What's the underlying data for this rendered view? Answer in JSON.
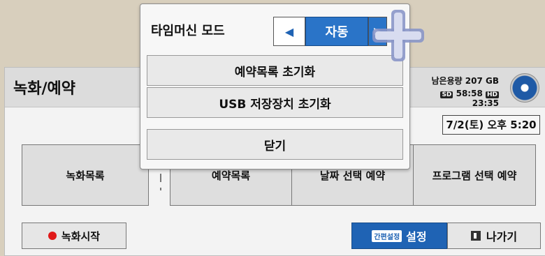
{
  "panel": {
    "title": "녹화/예약",
    "storage_remaining": "남은용량 207 GB",
    "sd_tag": "SD",
    "sd_time": "58:58",
    "hd_tag": "HD",
    "hd_time": "23:35",
    "datetime": "7/2(토) 오후 5:20"
  },
  "tabs": [
    {
      "label": "녹화목록"
    },
    {
      "label": "예약목록"
    },
    {
      "label": "날짜 선택 예약"
    },
    {
      "label": "프로그램 선택 예약"
    }
  ],
  "bottom": {
    "record_label": "녹화시작",
    "quick_tag": "간편설정",
    "settings_label": "설정",
    "exit_label": "나가기"
  },
  "popup": {
    "timemachine_label": "타임머신 모드",
    "mode_value": "자동",
    "left_arrow": "◀",
    "right_arrow": "▶",
    "items": [
      {
        "label": "예약목록 초기화"
      },
      {
        "label": "USB 저장장치 초기화"
      },
      {
        "label": "닫기"
      }
    ]
  },
  "colors": {
    "accent": "#2a74c8",
    "record_dot": "#e01919",
    "background": "#d8cfbd"
  },
  "icons": {
    "cursor": "plus-pointer-icon",
    "disc": "disc-icon",
    "exit": "exit-icon",
    "record": "record-dot-icon"
  }
}
